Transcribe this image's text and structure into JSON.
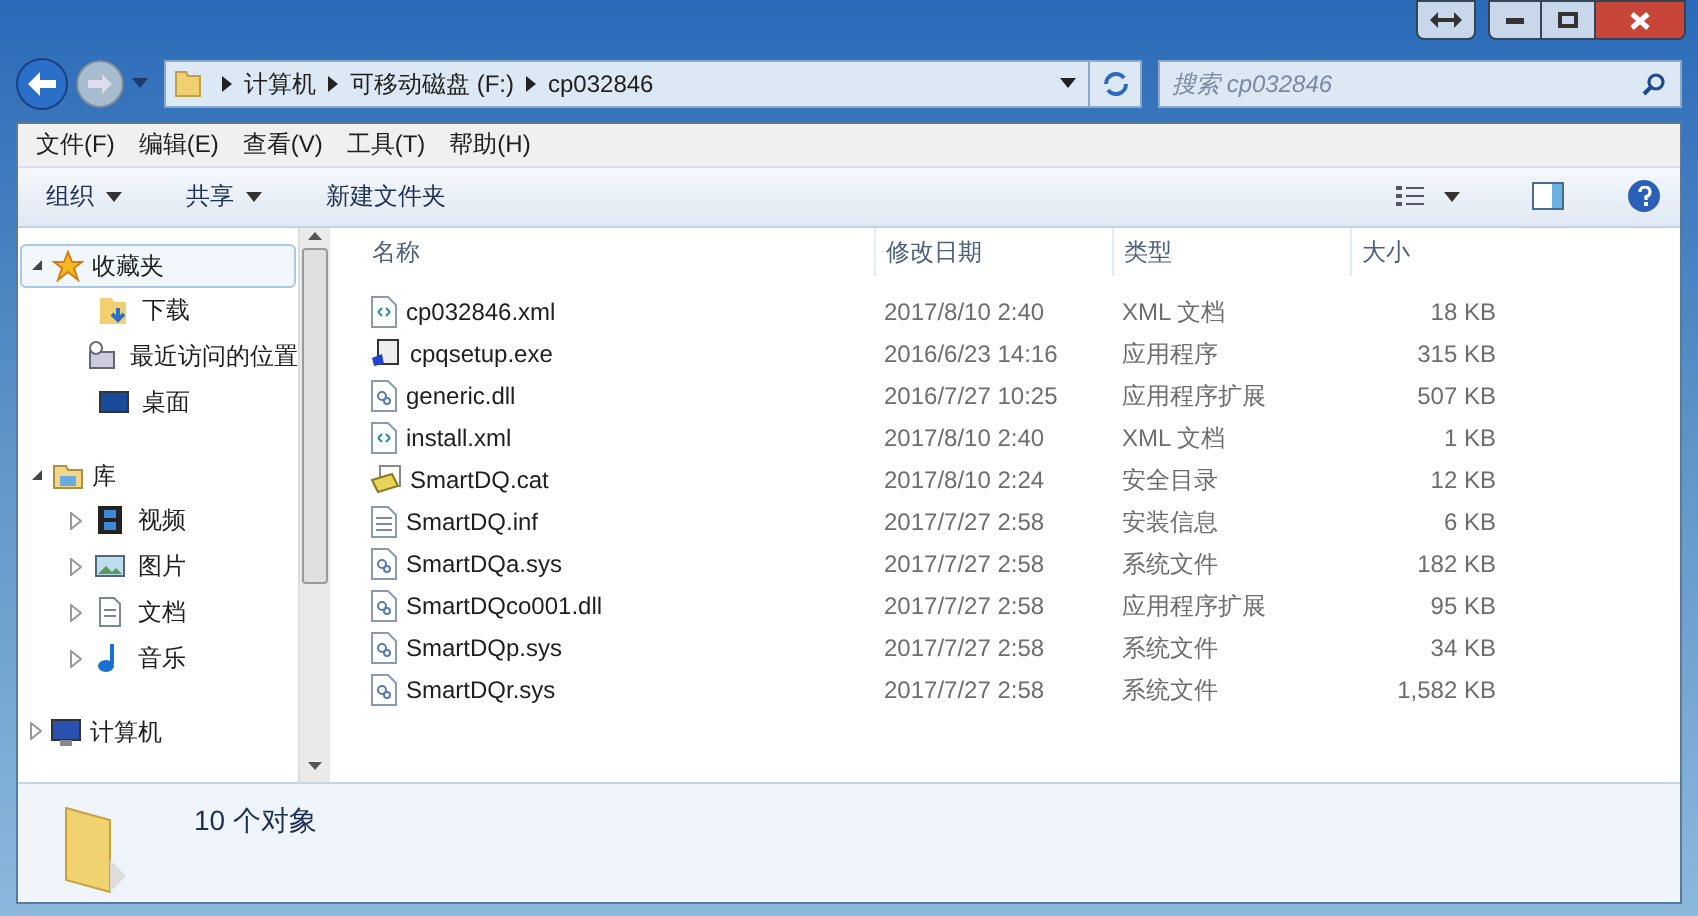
{
  "address_bar": {
    "crumbs": [
      "计算机",
      "可移动磁盘 (F:)",
      "cp032846"
    ]
  },
  "search": {
    "placeholder": "搜索 cp032846"
  },
  "menu_bar": [
    "文件(F)",
    "编辑(E)",
    "查看(V)",
    "工具(T)",
    "帮助(H)"
  ],
  "toolbar": [
    {
      "label": "组织",
      "dropdown": true
    },
    {
      "label": "共享",
      "dropdown": true
    },
    {
      "label": "新建文件夹",
      "dropdown": false
    }
  ],
  "sidebar": {
    "items": [
      {
        "label": "收藏夹",
        "kind": "star",
        "expanded": true,
        "selected": true,
        "children": [
          {
            "label": "下载",
            "kind": "download"
          },
          {
            "label": "最近访问的位置",
            "kind": "recent"
          },
          {
            "label": "桌面",
            "kind": "desktop"
          }
        ]
      },
      {
        "label": "库",
        "kind": "library",
        "expanded": true,
        "selected": false,
        "children": [
          {
            "label": "视频",
            "kind": "video",
            "expanded": false
          },
          {
            "label": "图片",
            "kind": "picture",
            "expanded": false
          },
          {
            "label": "文档",
            "kind": "document",
            "expanded": false
          },
          {
            "label": "音乐",
            "kind": "music",
            "expanded": false
          }
        ]
      },
      {
        "label": "计算机",
        "kind": "computer",
        "expanded": false,
        "selected": false
      }
    ]
  },
  "table": {
    "columns": [
      "名称",
      "修改日期",
      "类型",
      "大小"
    ],
    "rows": [
      {
        "name": "cp032846.xml",
        "kind": "xml",
        "date": "2017/8/10 2:40",
        "type": "XML 文档",
        "size": "18 KB"
      },
      {
        "name": "cpqsetup.exe",
        "kind": "exe",
        "date": "2016/6/23 14:16",
        "type": "应用程序",
        "size": "315 KB"
      },
      {
        "name": "generic.dll",
        "kind": "dll",
        "date": "2016/7/27 10:25",
        "type": "应用程序扩展",
        "size": "507 KB"
      },
      {
        "name": "install.xml",
        "kind": "xml",
        "date": "2017/8/10 2:40",
        "type": "XML 文档",
        "size": "1 KB"
      },
      {
        "name": "SmartDQ.cat",
        "kind": "cat",
        "date": "2017/8/10 2:24",
        "type": "安全目录",
        "size": "12 KB"
      },
      {
        "name": "SmartDQ.inf",
        "kind": "inf",
        "date": "2017/7/27 2:58",
        "type": "安装信息",
        "size": "6 KB"
      },
      {
        "name": "SmartDQa.sys",
        "kind": "dll",
        "date": "2017/7/27 2:58",
        "type": "系统文件",
        "size": "182 KB"
      },
      {
        "name": "SmartDQco001.dll",
        "kind": "dll",
        "date": "2017/7/27 2:58",
        "type": "应用程序扩展",
        "size": "95 KB"
      },
      {
        "name": "SmartDQp.sys",
        "kind": "dll",
        "date": "2017/7/27 2:58",
        "type": "系统文件",
        "size": "34 KB"
      },
      {
        "name": "SmartDQr.sys",
        "kind": "dll",
        "date": "2017/7/27 2:58",
        "type": "系统文件",
        "size": "1,582 KB"
      }
    ]
  },
  "details_pane": {
    "summary": "10 个对象"
  }
}
